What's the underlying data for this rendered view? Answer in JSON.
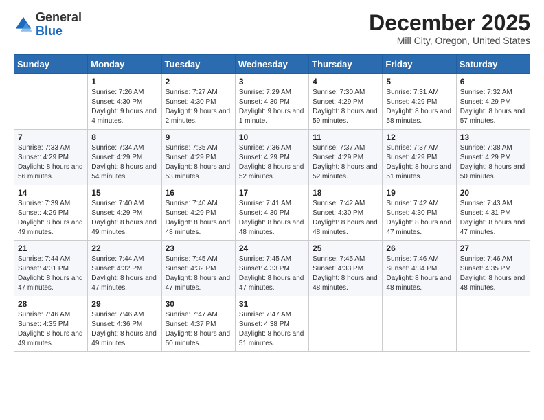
{
  "header": {
    "logo_general": "General",
    "logo_blue": "Blue",
    "month_title": "December 2025",
    "location": "Mill City, Oregon, United States"
  },
  "weekdays": [
    "Sunday",
    "Monday",
    "Tuesday",
    "Wednesday",
    "Thursday",
    "Friday",
    "Saturday"
  ],
  "weeks": [
    [
      {
        "day": "",
        "sunrise": "",
        "sunset": "",
        "daylight": ""
      },
      {
        "day": "1",
        "sunrise": "Sunrise: 7:26 AM",
        "sunset": "Sunset: 4:30 PM",
        "daylight": "Daylight: 9 hours and 4 minutes."
      },
      {
        "day": "2",
        "sunrise": "Sunrise: 7:27 AM",
        "sunset": "Sunset: 4:30 PM",
        "daylight": "Daylight: 9 hours and 2 minutes."
      },
      {
        "day": "3",
        "sunrise": "Sunrise: 7:29 AM",
        "sunset": "Sunset: 4:30 PM",
        "daylight": "Daylight: 9 hours and 1 minute."
      },
      {
        "day": "4",
        "sunrise": "Sunrise: 7:30 AM",
        "sunset": "Sunset: 4:29 PM",
        "daylight": "Daylight: 8 hours and 59 minutes."
      },
      {
        "day": "5",
        "sunrise": "Sunrise: 7:31 AM",
        "sunset": "Sunset: 4:29 PM",
        "daylight": "Daylight: 8 hours and 58 minutes."
      },
      {
        "day": "6",
        "sunrise": "Sunrise: 7:32 AM",
        "sunset": "Sunset: 4:29 PM",
        "daylight": "Daylight: 8 hours and 57 minutes."
      }
    ],
    [
      {
        "day": "7",
        "sunrise": "Sunrise: 7:33 AM",
        "sunset": "Sunset: 4:29 PM",
        "daylight": "Daylight: 8 hours and 56 minutes."
      },
      {
        "day": "8",
        "sunrise": "Sunrise: 7:34 AM",
        "sunset": "Sunset: 4:29 PM",
        "daylight": "Daylight: 8 hours and 54 minutes."
      },
      {
        "day": "9",
        "sunrise": "Sunrise: 7:35 AM",
        "sunset": "Sunset: 4:29 PM",
        "daylight": "Daylight: 8 hours and 53 minutes."
      },
      {
        "day": "10",
        "sunrise": "Sunrise: 7:36 AM",
        "sunset": "Sunset: 4:29 PM",
        "daylight": "Daylight: 8 hours and 52 minutes."
      },
      {
        "day": "11",
        "sunrise": "Sunrise: 7:37 AM",
        "sunset": "Sunset: 4:29 PM",
        "daylight": "Daylight: 8 hours and 52 minutes."
      },
      {
        "day": "12",
        "sunrise": "Sunrise: 7:37 AM",
        "sunset": "Sunset: 4:29 PM",
        "daylight": "Daylight: 8 hours and 51 minutes."
      },
      {
        "day": "13",
        "sunrise": "Sunrise: 7:38 AM",
        "sunset": "Sunset: 4:29 PM",
        "daylight": "Daylight: 8 hours and 50 minutes."
      }
    ],
    [
      {
        "day": "14",
        "sunrise": "Sunrise: 7:39 AM",
        "sunset": "Sunset: 4:29 PM",
        "daylight": "Daylight: 8 hours and 49 minutes."
      },
      {
        "day": "15",
        "sunrise": "Sunrise: 7:40 AM",
        "sunset": "Sunset: 4:29 PM",
        "daylight": "Daylight: 8 hours and 49 minutes."
      },
      {
        "day": "16",
        "sunrise": "Sunrise: 7:40 AM",
        "sunset": "Sunset: 4:29 PM",
        "daylight": "Daylight: 8 hours and 48 minutes."
      },
      {
        "day": "17",
        "sunrise": "Sunrise: 7:41 AM",
        "sunset": "Sunset: 4:30 PM",
        "daylight": "Daylight: 8 hours and 48 minutes."
      },
      {
        "day": "18",
        "sunrise": "Sunrise: 7:42 AM",
        "sunset": "Sunset: 4:30 PM",
        "daylight": "Daylight: 8 hours and 48 minutes."
      },
      {
        "day": "19",
        "sunrise": "Sunrise: 7:42 AM",
        "sunset": "Sunset: 4:30 PM",
        "daylight": "Daylight: 8 hours and 47 minutes."
      },
      {
        "day": "20",
        "sunrise": "Sunrise: 7:43 AM",
        "sunset": "Sunset: 4:31 PM",
        "daylight": "Daylight: 8 hours and 47 minutes."
      }
    ],
    [
      {
        "day": "21",
        "sunrise": "Sunrise: 7:44 AM",
        "sunset": "Sunset: 4:31 PM",
        "daylight": "Daylight: 8 hours and 47 minutes."
      },
      {
        "day": "22",
        "sunrise": "Sunrise: 7:44 AM",
        "sunset": "Sunset: 4:32 PM",
        "daylight": "Daylight: 8 hours and 47 minutes."
      },
      {
        "day": "23",
        "sunrise": "Sunrise: 7:45 AM",
        "sunset": "Sunset: 4:32 PM",
        "daylight": "Daylight: 8 hours and 47 minutes."
      },
      {
        "day": "24",
        "sunrise": "Sunrise: 7:45 AM",
        "sunset": "Sunset: 4:33 PM",
        "daylight": "Daylight: 8 hours and 47 minutes."
      },
      {
        "day": "25",
        "sunrise": "Sunrise: 7:45 AM",
        "sunset": "Sunset: 4:33 PM",
        "daylight": "Daylight: 8 hours and 48 minutes."
      },
      {
        "day": "26",
        "sunrise": "Sunrise: 7:46 AM",
        "sunset": "Sunset: 4:34 PM",
        "daylight": "Daylight: 8 hours and 48 minutes."
      },
      {
        "day": "27",
        "sunrise": "Sunrise: 7:46 AM",
        "sunset": "Sunset: 4:35 PM",
        "daylight": "Daylight: 8 hours and 48 minutes."
      }
    ],
    [
      {
        "day": "28",
        "sunrise": "Sunrise: 7:46 AM",
        "sunset": "Sunset: 4:35 PM",
        "daylight": "Daylight: 8 hours and 49 minutes."
      },
      {
        "day": "29",
        "sunrise": "Sunrise: 7:46 AM",
        "sunset": "Sunset: 4:36 PM",
        "daylight": "Daylight: 8 hours and 49 minutes."
      },
      {
        "day": "30",
        "sunrise": "Sunrise: 7:47 AM",
        "sunset": "Sunset: 4:37 PM",
        "daylight": "Daylight: 8 hours and 50 minutes."
      },
      {
        "day": "31",
        "sunrise": "Sunrise: 7:47 AM",
        "sunset": "Sunset: 4:38 PM",
        "daylight": "Daylight: 8 hours and 51 minutes."
      },
      {
        "day": "",
        "sunrise": "",
        "sunset": "",
        "daylight": ""
      },
      {
        "day": "",
        "sunrise": "",
        "sunset": "",
        "daylight": ""
      },
      {
        "day": "",
        "sunrise": "",
        "sunset": "",
        "daylight": ""
      }
    ]
  ]
}
